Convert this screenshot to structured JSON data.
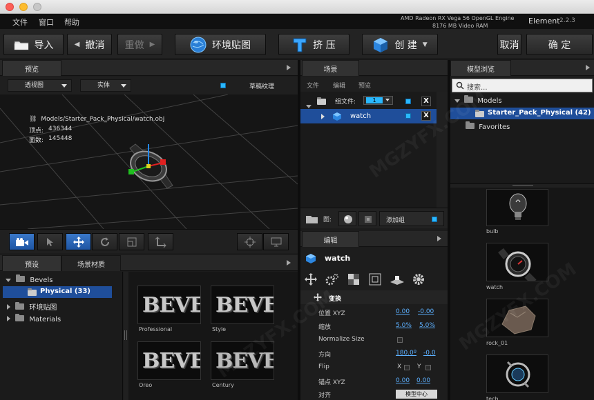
{
  "menubar": {
    "items": [
      "文件",
      "窗口",
      "帮助"
    ],
    "gpu_line1": "AMD Radeon RX Vega 56 OpenGL Engine",
    "gpu_line2": "8176 MB Video RAM",
    "app_name": "Element",
    "app_version": "2.2.3"
  },
  "toolbar": {
    "import": "导入",
    "undo": "撤消",
    "redo": "重做",
    "env_map": "环境贴图",
    "extrude": "挤 压",
    "create": "创 建",
    "cancel": "取消",
    "ok": "确 定"
  },
  "preview": {
    "tab": "预览",
    "view_select": "透视图",
    "render_select": "实体",
    "draft_texture": "草稿纹理",
    "draft_texture_checked": true,
    "file_path": "Models/Starter_Pack_Physical/watch.obj",
    "vertex_label": "顶点:",
    "vertex_value": "436344",
    "face_label": "面数:",
    "face_value": "145448"
  },
  "scene": {
    "tab": "场景",
    "menu": [
      "文件",
      "编辑",
      "预览"
    ],
    "group_label": "组文件:",
    "group_num": "1",
    "item": "watch",
    "add_group": "添加组",
    "map_label": "图:"
  },
  "model_browser": {
    "tab": "模型浏览",
    "search_placeholder": "搜索...",
    "tree": [
      {
        "label": "Models"
      },
      {
        "label": "Starter_Pack_Physical (42)"
      },
      {
        "label": "Favorites"
      }
    ],
    "models": [
      "bulb",
      "watch",
      "rock_01",
      "tech"
    ]
  },
  "presets": {
    "tab1": "预设",
    "tab2": "场景材质",
    "tree": [
      {
        "label": "Bevels"
      },
      {
        "label": "Physical (33)"
      },
      {
        "label": "环境贴图"
      },
      {
        "label": "Materials"
      }
    ],
    "thumb_text": "BEVEL",
    "items": [
      "Professional",
      "Style",
      "Oreo",
      "Century"
    ]
  },
  "edit": {
    "tab": "编辑",
    "object_name": "watch",
    "section": "变换",
    "props": [
      {
        "label": "位置 XYZ",
        "v1": "0.00",
        "v2": "-0.00"
      },
      {
        "label": "缩放",
        "v1": "5.0%",
        "v2": "5.0%"
      },
      {
        "label": "Normalize Size"
      },
      {
        "label": "方向",
        "v1": "180.0º",
        "v2": "-0.0"
      },
      {
        "label": "Flip",
        "x": "X",
        "y": "Y"
      },
      {
        "label": "锚点 XYZ",
        "v1": "0.00",
        "v2": "0.00"
      },
      {
        "label": "对齐",
        "btn": "模型中心"
      }
    ]
  },
  "colors": {
    "accent": "#29b8ff",
    "selection": "#1f4e9a",
    "value_link": "#5cb0ff"
  },
  "watermark": "MGZYFX.COM"
}
